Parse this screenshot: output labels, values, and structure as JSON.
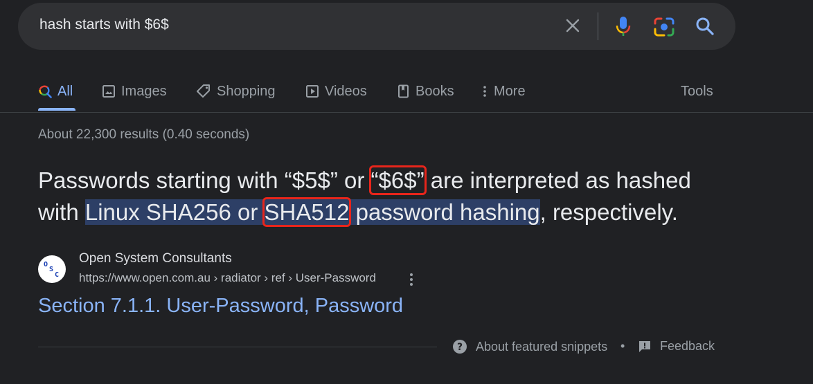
{
  "search": {
    "query": "hash starts with $6$"
  },
  "tabs": [
    {
      "label": "All",
      "icon": "google-color-search-icon"
    },
    {
      "label": "Images",
      "icon": "image-icon"
    },
    {
      "label": "Shopping",
      "icon": "tag-icon"
    },
    {
      "label": "Videos",
      "icon": "play-icon"
    },
    {
      "label": "Books",
      "icon": "book-icon"
    },
    {
      "label": "More",
      "icon": "vertical-dots-icon"
    }
  ],
  "tools_label": "Tools",
  "result_stats": "About 22,300 results (0.40 seconds)",
  "snippet": {
    "t1": "Passwords starting with “$5$” or ",
    "box1": "“$6$”",
    "t2": " are interpreted as hashed with ",
    "hl1": "Linux SHA256 or ",
    "box2": "SHA512",
    "hl2": " password hashing",
    "t3": ", respectively."
  },
  "source": {
    "favicon_text": "OSC",
    "name": "Open System Consultants",
    "url": "https://www.open.com.au › radiator › ref › User-Password",
    "title": "Section 7.1.1. User-Password, Password"
  },
  "footer": {
    "about": "About featured snippets",
    "separator": "•",
    "feedback": "Feedback"
  },
  "colors": {
    "background": "#202124",
    "link": "#8ab4f8",
    "highlight": "#2d3f66",
    "annotation_box": "#e8251b"
  }
}
